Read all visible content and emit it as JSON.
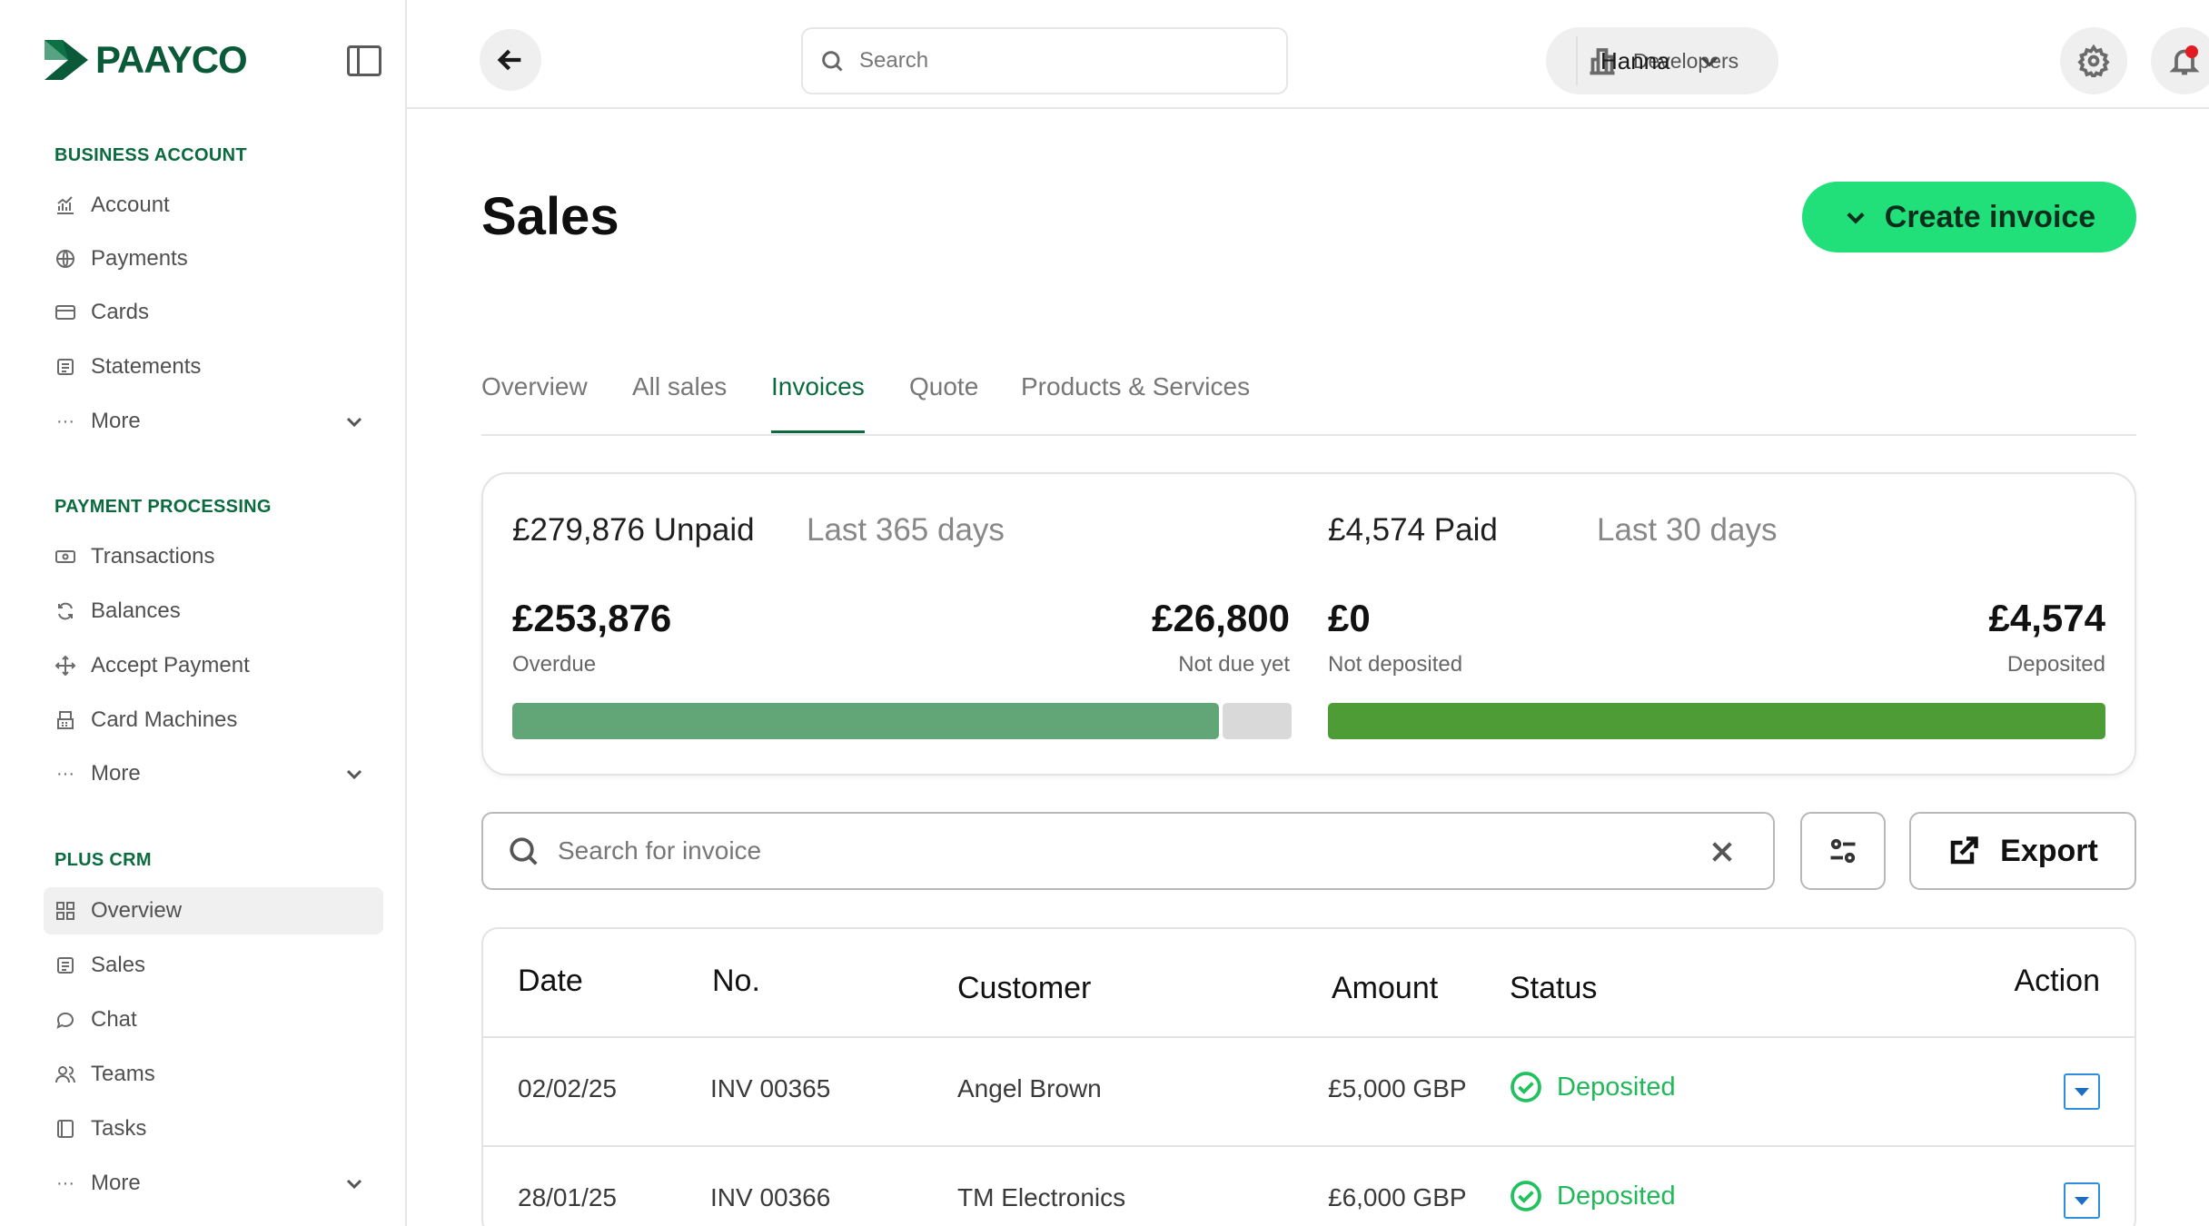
{
  "app": {
    "brand": "PAAYCO",
    "brand_color": "#0a5a3a",
    "accent_color": "#21e07a",
    "brand_green": "#0b6b3f"
  },
  "sidebar": {
    "sections": [
      {
        "title": "BUSINESS ACCOUNT",
        "items": [
          {
            "label": "Account",
            "icon": "chart-icon"
          },
          {
            "label": "Payments",
            "icon": "globe-icon"
          },
          {
            "label": "Cards",
            "icon": "card-icon"
          },
          {
            "label": "Statements",
            "icon": "document-icon"
          },
          {
            "label": "More",
            "icon": "more-icon"
          }
        ]
      },
      {
        "title": "PAYMENT PROCESSING",
        "items": [
          {
            "label": "Transactions",
            "icon": "transactions-icon"
          },
          {
            "label": "Balances",
            "icon": "refresh-icon"
          },
          {
            "label": "Accept Payment",
            "icon": "move-icon"
          },
          {
            "label": "Card Machines",
            "icon": "card-machine-icon"
          },
          {
            "label": "More",
            "icon": "more-icon"
          }
        ]
      },
      {
        "title": "PLUS CRM",
        "items": [
          {
            "label": "Overview",
            "icon": "grid-icon",
            "active": true
          },
          {
            "label": "Sales",
            "icon": "document-icon"
          },
          {
            "label": "Chat",
            "icon": "chat-icon"
          },
          {
            "label": "Teams",
            "icon": "users-icon"
          },
          {
            "label": "Tasks",
            "icon": "tasks-icon"
          },
          {
            "label": "More",
            "icon": "more-icon"
          }
        ]
      }
    ]
  },
  "topbar": {
    "search_placeholder": "Search",
    "developers_label": "Developers",
    "user_name": "Hanna"
  },
  "page": {
    "title": "Sales",
    "create_button": "Create invoice",
    "tabs": [
      "Overview",
      "All sales",
      "Invoices",
      "Quote",
      "Products & Services"
    ],
    "active_tab": "Invoices"
  },
  "summary": {
    "unpaid": {
      "heading": "£279,876 Unpaid",
      "period": "Last 365 days",
      "overdue_value": "£253,876",
      "overdue_label": "Overdue",
      "not_due_value": "£26,800",
      "not_due_label": "Not due yet",
      "overdue_fraction": 0.907,
      "overdue_color": "#62a678",
      "not_due_color": "#d9d9d9"
    },
    "paid": {
      "heading": "£4,574 Paid",
      "period": "Last 30 days",
      "not_deposited_value": "£0",
      "not_deposited_label": "Not deposited",
      "deposited_value": "£4,574",
      "deposited_label": "Deposited",
      "deposited_fraction": 1.0,
      "deposited_color": "#4d9c36"
    }
  },
  "invoice_search": {
    "placeholder": "Search for invoice",
    "export_label": "Export"
  },
  "table": {
    "headers": {
      "date": "Date",
      "no": "No.",
      "customer": "Customer",
      "amount": "Amount",
      "status": "Status",
      "action": "Action"
    },
    "rows": [
      {
        "date": "02/02/25",
        "no": "INV 00365",
        "customer": "Angel Brown",
        "amount": "£5,000 GBP",
        "status": "Deposited"
      },
      {
        "date": "28/01/25",
        "no": "INV 00366",
        "customer": "TM Electronics",
        "amount": "£6,000 GBP",
        "status": "Deposited"
      }
    ]
  }
}
